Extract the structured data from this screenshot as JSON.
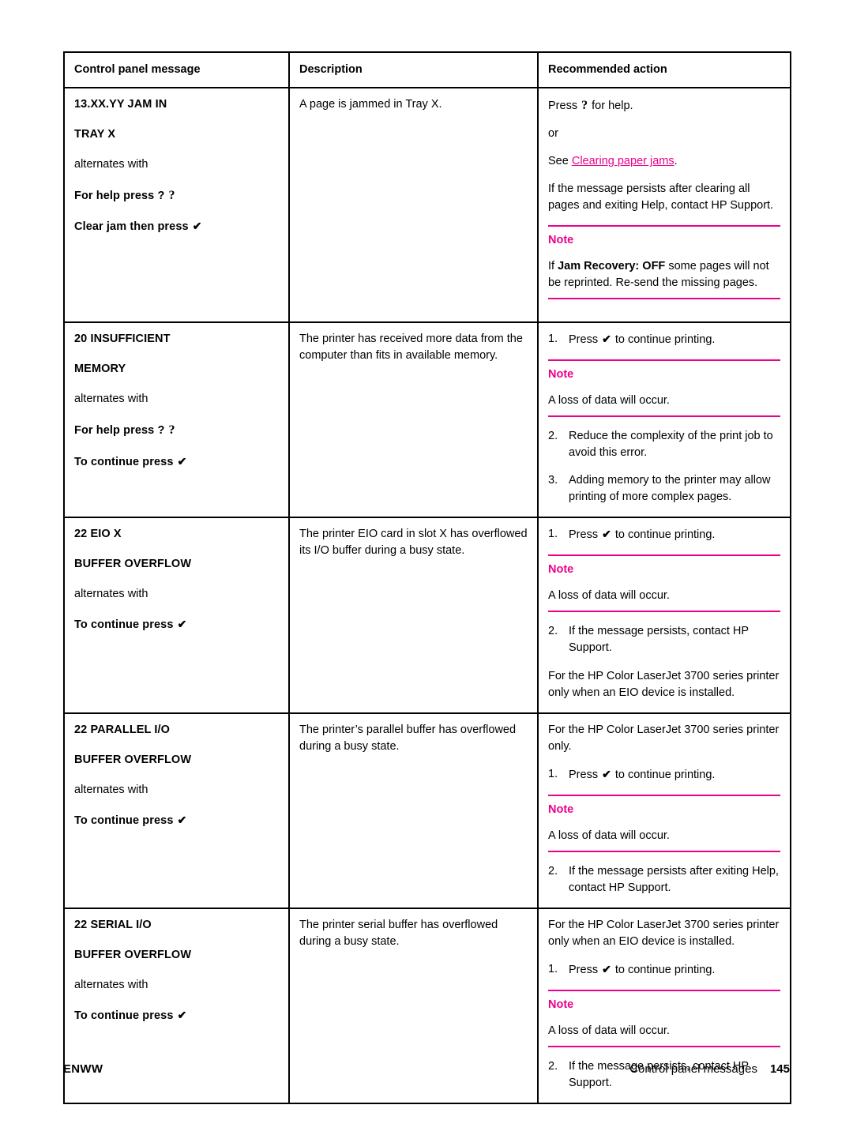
{
  "table": {
    "headers": [
      "Control panel message",
      "Description",
      "Recommended action"
    ],
    "rows": [
      {
        "message": {
          "lines": [
            "13.XX.YY JAM IN",
            "TRAY X"
          ],
          "alternates_label": "alternates with",
          "alt_lines": [
            "For help press ?",
            "Clear jam then press"
          ]
        },
        "description": "A page is jammed in Tray X.",
        "action": {
          "p1": "Press",
          "p1_tail": "for help.",
          "p2": "or",
          "p3_prefix": "See",
          "p3_link": "Clearing paper jams",
          "p3_suffix": ".",
          "p4": "If the message persists after clearing all pages and exiting Help, contact HP Support.",
          "note_label": "Note",
          "note_prefix": "If",
          "note_bold": "Jam Recovery: OFF",
          "note_suffix": "some pages will not be reprinted. Re-send the missing pages."
        }
      },
      {
        "message": {
          "lines": [
            "20 INSUFFICIENT",
            "MEMORY"
          ],
          "alternates_label": "alternates with",
          "alt_lines": [
            "For help press ?",
            "To continue press"
          ]
        },
        "description": "The printer has received more data from the computer than fits in available memory.",
        "action": {
          "item1_num": "1.",
          "item1_prefix": "Press",
          "item1_suffix": "to continue printing.",
          "note_label": "Note",
          "note_body": "A loss of data will occur.",
          "item2_num": "2.",
          "item2": "Reduce the complexity of the print job to avoid this error.",
          "item3_num": "3.",
          "item3": "Adding memory to the printer may allow printing of more complex pages."
        }
      },
      {
        "message": {
          "lines": [
            "22 EIO X",
            "BUFFER OVERFLOW"
          ],
          "alternates_label": "alternates with",
          "alt_lines": [
            "To continue press"
          ]
        },
        "description": "The printer EIO card in slot X has overflowed its I/O buffer during a busy state.",
        "action": {
          "item1_num": "1.",
          "item1_prefix": "Press",
          "item1_suffix": "to continue printing.",
          "note_label": "Note",
          "note_body": "A loss of data will occur.",
          "item2_num": "2.",
          "item2": "If the message persists, contact HP Support.",
          "trailer": "For the HP Color LaserJet 3700 series printer only when an EIO device is installed."
        }
      },
      {
        "message": {
          "lines": [
            "22 PARALLEL I/O",
            "BUFFER OVERFLOW"
          ],
          "alternates_label": "alternates with",
          "alt_lines": [
            "To continue press"
          ]
        },
        "description": "The printer’s parallel buffer has overflowed during a busy state.",
        "action": {
          "lead": "For the HP Color LaserJet 3700 series printer only.",
          "item1_num": "1.",
          "item1_prefix": "Press",
          "item1_suffix": "to continue printing.",
          "note_label": "Note",
          "note_body": "A loss of data will occur.",
          "item2_num": "2.",
          "item2": "If the message persists after exiting Help, contact HP Support."
        }
      },
      {
        "message": {
          "lines": [
            "22 SERIAL I/O",
            "BUFFER OVERFLOW"
          ],
          "alternates_label": "alternates with",
          "alt_lines": [
            "To continue press"
          ]
        },
        "description": "The printer serial buffer has overflowed during a busy state.",
        "action": {
          "lead": "For the HP Color LaserJet 3700 series printer only when an EIO device is installed.",
          "item1_num": "1.",
          "item1_prefix": "Press",
          "item1_suffix": "to continue printing.",
          "note_label": "Note",
          "note_body": "A loss of data will occur.",
          "item2_num": "2.",
          "item2": "If the message persists, contact HP Support."
        }
      }
    ]
  },
  "glyphs": {
    "check": "✔",
    "help": "?"
  },
  "footer": {
    "left": "ENWW",
    "chapter": "Control panel messages",
    "page": "145"
  },
  "colors": {
    "accent": "#ec008c",
    "text": "#000000",
    "border": "#000000"
  }
}
